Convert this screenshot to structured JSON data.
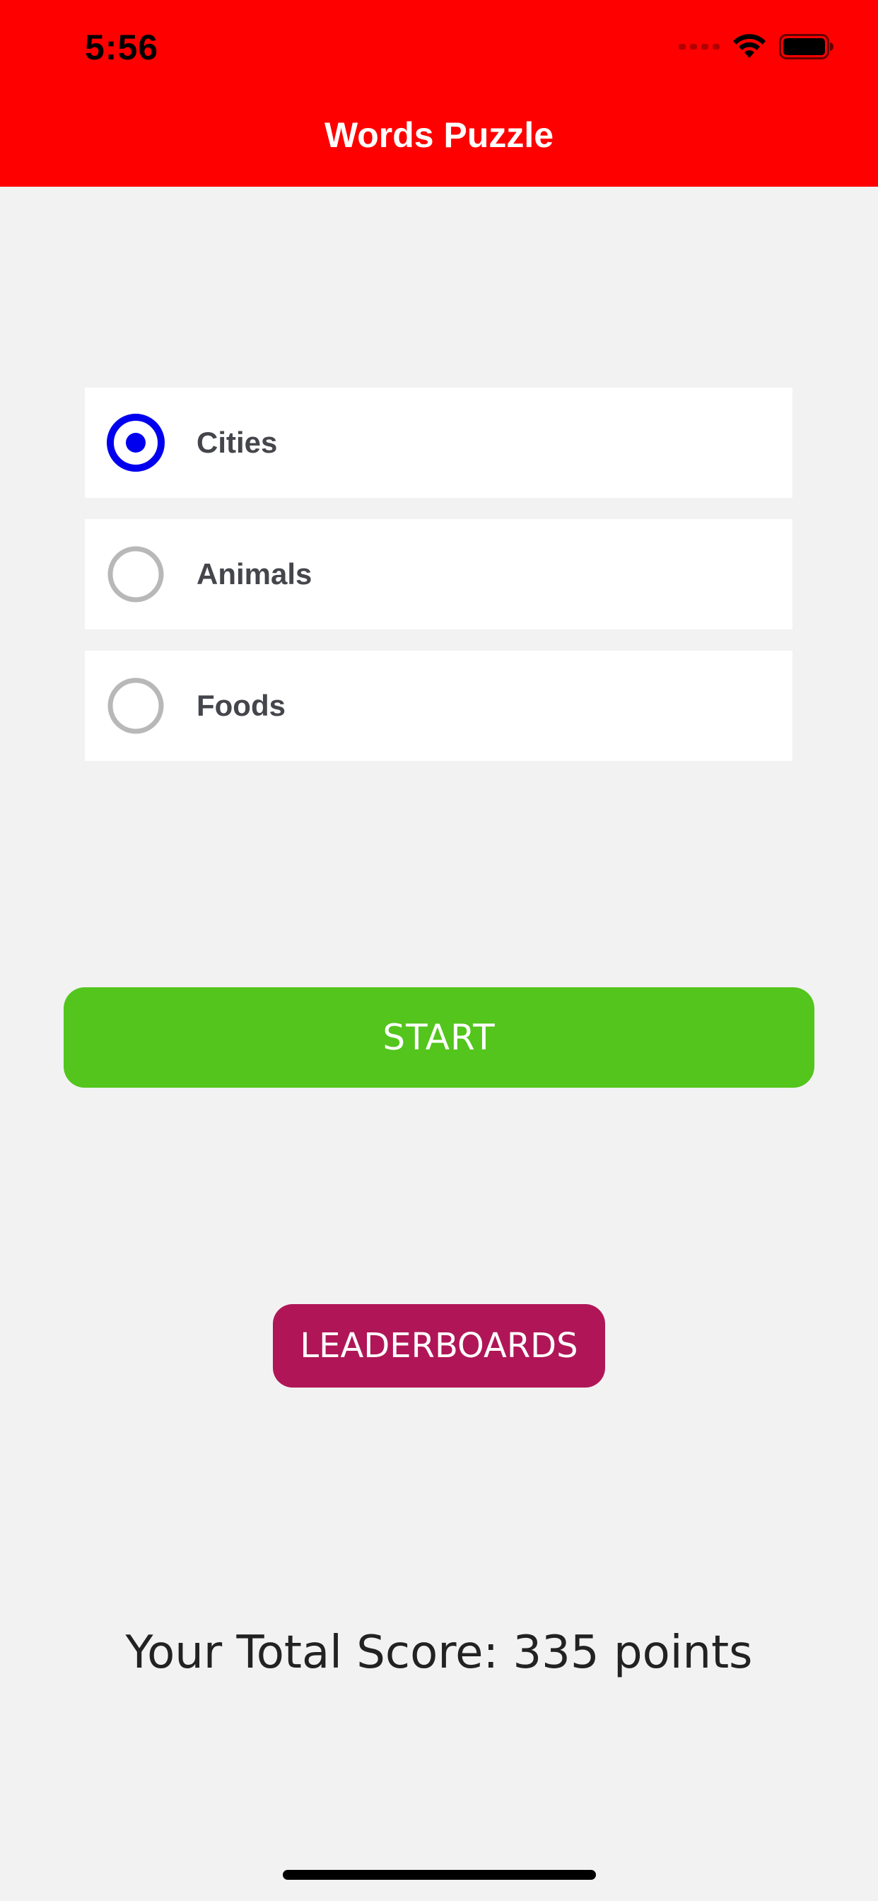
{
  "status_bar": {
    "time": "5:56",
    "icons": [
      "cellular-dots-icon",
      "wifi-icon",
      "battery-icon"
    ]
  },
  "header": {
    "title": "Words Puzzle",
    "background_color": "#ff0000"
  },
  "categories": {
    "selected": "Cities",
    "items": [
      {
        "label": "Cities",
        "selected": true
      },
      {
        "label": "Animals",
        "selected": false
      },
      {
        "label": "Foods",
        "selected": false
      }
    ],
    "selected_radio_color": "#0000ee",
    "unselected_radio_color": "#b8b8b8"
  },
  "actions": {
    "start_label": "START",
    "start_color": "#53c51c",
    "leaderboards_label": "LEADERBOARDS",
    "leaderboards_color": "#b01657"
  },
  "score": {
    "text": "Your Total Score: 335 points"
  }
}
